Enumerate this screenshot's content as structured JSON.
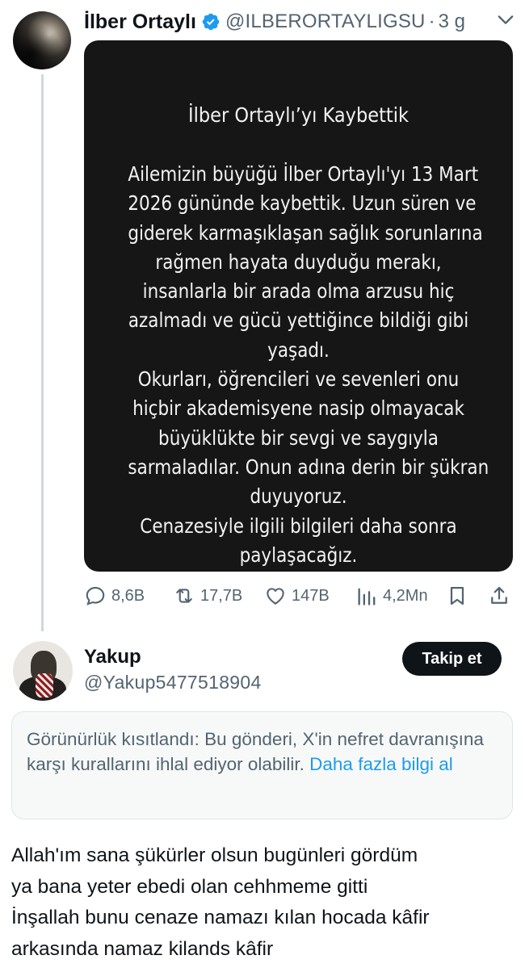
{
  "tweet": {
    "author_name": "İlber Ortaylı",
    "handle": "@ILBERORTAYLIGSU",
    "separator": "·",
    "time": "3 g",
    "image_text": {
      "title": "İlber Ortaylı’yı Kaybettik",
      "lines": [
        "Ailemizin büyüğü İlber Ortaylı'yı 13 Mart",
        "2026 gününde kaybettik. Uzun süren ve",
        "giderek karmaşıklaşan sağlık sorunlarına",
        "rağmen hayata duyduğu merakı,",
        "insanlarla bir arada olma arzusu hiç",
        "azalmadı ve gücü yettiğince bildiği gibi",
        "yaşadı.",
        "Okurları, öğrencileri ve sevenleri onu",
        "hiçbir akademisyene nasip olmayacak",
        "büyüklükte bir sevgi ve saygıyla",
        "sarmaladılar. Onun adına derin bir şükran",
        "duyuyoruz.",
        "Cenazesiyle ilgili bilgileri daha sonra",
        "paylaşacağız."
      ]
    },
    "stats": {
      "replies": "8,6B",
      "reposts": "17,7B",
      "likes": "147B",
      "views": "4,2Mn"
    }
  },
  "reply": {
    "author_name": "Yakup",
    "handle": "@Yakup5477518904",
    "follow_label": "Takip et",
    "notice": {
      "text": "Görünürlük kısıtlandı: Bu gönderi, X'in nefret davranışına karşı kurallarını ihlal ediyor olabilir. ",
      "link": "Daha fazla bilgi al"
    },
    "text_lines": [
      "Allah'ım sana şükürler olsun bugünleri gördüm",
      "ya bana yeter ebedi olan cehhmeme gitti",
      "İnşallah bunu cenaze namazı kılan hocada kâfir",
      "arkasında namaz kilands kâfir"
    ]
  },
  "colors": {
    "text": "#0f1419",
    "secondary": "#536471",
    "link": "#1d9bf0",
    "media_bg": "#161616",
    "verified": "#1d9bf0"
  }
}
